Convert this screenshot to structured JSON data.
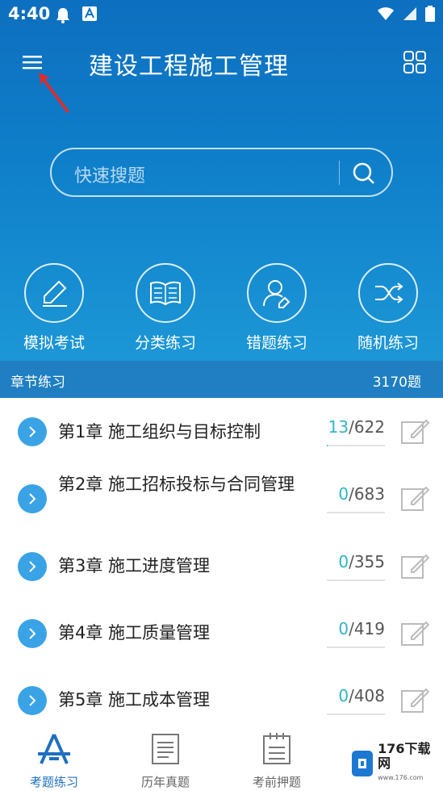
{
  "status_bar": {
    "time": "4:40"
  },
  "header": {
    "title": "建设工程施工管理"
  },
  "search": {
    "placeholder": "快速搜题"
  },
  "features": [
    {
      "label": "模拟考试",
      "icon": "pencil-icon"
    },
    {
      "label": "分类练习",
      "icon": "book-icon"
    },
    {
      "label": "错题练习",
      "icon": "user-edit-icon"
    },
    {
      "label": "随机练习",
      "icon": "shuffle-icon"
    }
  ],
  "section": {
    "title": "章节练习",
    "total": "3170题"
  },
  "chapters": [
    {
      "title": "第1章 施工组织与目标控制",
      "done": "13",
      "total": "/622",
      "progress": 0.02
    },
    {
      "title": "第2章 施工招标投标与合同管理",
      "done": "0",
      "total": "/683",
      "progress": 0
    },
    {
      "title": "第3章 施工进度管理",
      "done": "0",
      "total": "/355",
      "progress": 0
    },
    {
      "title": "第4章 施工质量管理",
      "done": "0",
      "total": "/419",
      "progress": 0
    },
    {
      "title": "第5章 施工成本管理",
      "done": "0",
      "total": "/408",
      "progress": 0
    }
  ],
  "tabs": [
    {
      "label": "考题练习",
      "icon": "compass-icon",
      "active": true
    },
    {
      "label": "历年真题",
      "icon": "document-icon",
      "active": false
    },
    {
      "label": "考前押题",
      "icon": "clipboard-icon",
      "active": false
    }
  ],
  "watermark": {
    "text": "176下载网",
    "sub": "www.176.com"
  },
  "colors": {
    "hero": "#0f7fca",
    "section_bar": "#1f7fc2",
    "accent": "#2eb6c3",
    "chevron": "#3aa3e6"
  }
}
